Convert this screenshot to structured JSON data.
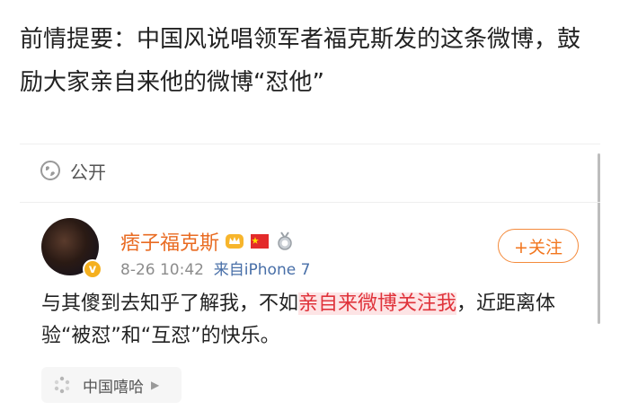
{
  "intro_text": "前情提要：中国风说唱领军者福克斯发的这条微博，鼓励大家亲自来他的微博“怼他”",
  "privacy_label": "公开",
  "user": {
    "name": "痞子福克斯",
    "verified_badge": "v"
  },
  "meta": {
    "date": "8-26 10:42",
    "source": "来自iPhone 7"
  },
  "follow_label": "+关注",
  "post": {
    "before": "与其傻到去知乎了解我，不如",
    "highlight": "亲自来微博关注我",
    "after": "，近距离体验“被怼”和“互怼”的快乐。"
  },
  "topic_label": "中国嘻哈",
  "colors": {
    "accent_orange": "#f2761e",
    "highlight_red": "#e0333b",
    "highlight_bg": "#fde4e5"
  }
}
